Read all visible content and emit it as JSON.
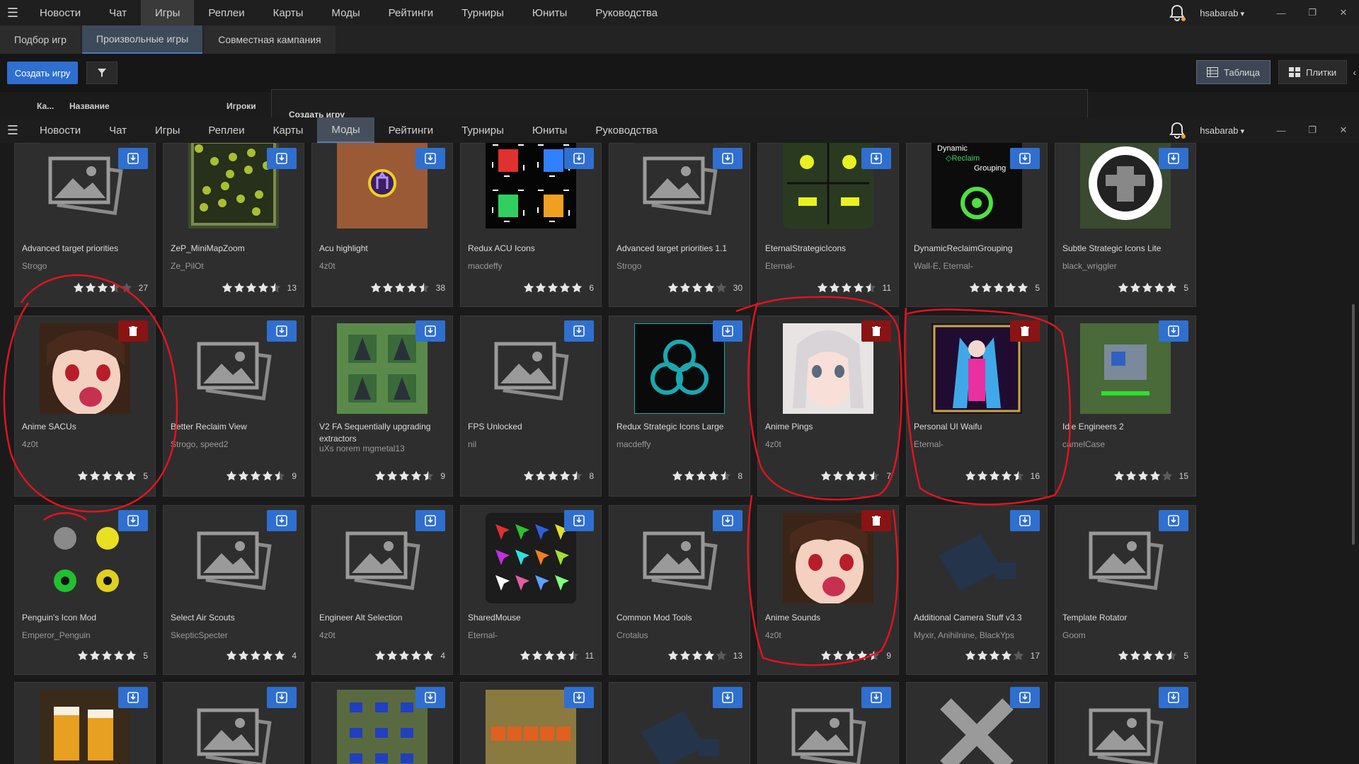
{
  "back_window": {
    "nav": [
      "Новости",
      "Чат",
      "Игры",
      "Реплеи",
      "Карты",
      "Моды",
      "Рейтинги",
      "Турниры",
      "Юниты",
      "Руководства"
    ],
    "active_nav": 2,
    "user": "hsabarab",
    "subtabs": [
      "Подбор игр",
      "Произвольные игры",
      "Совместная кампания"
    ],
    "active_subtab": 1,
    "create_button": "Создать игру",
    "view_table": "Таблица",
    "view_tiles": "Плитки",
    "table_headers": {
      "col1": "Ка...",
      "col2": "Название",
      "col3": "Игроки"
    },
    "create_panel_title": "Создать игру"
  },
  "front_window": {
    "nav": [
      "Новости",
      "Чат",
      "Игры",
      "Реплеи",
      "Карты",
      "Моды",
      "Рейтинги",
      "Турниры",
      "Юниты",
      "Руководства"
    ],
    "active_nav": 5,
    "user": "hsabarab"
  },
  "window_controls": {
    "minimize": "—",
    "maximize": "❐",
    "close": "✕"
  },
  "colors": {
    "accent": "#2f6fd0",
    "delete": "#8a1414",
    "annotation": "#e0141e"
  },
  "mods": [
    {
      "name": "Advanced target priorities",
      "author": "Strogo",
      "rating": 3.5,
      "count": "27",
      "action": "download",
      "image": "placeholder"
    },
    {
      "name": "ZeP_MiniMapZoom",
      "author": "Ze_PilOt",
      "rating": 4.5,
      "count": "13",
      "action": "download",
      "image": "minimap"
    },
    {
      "name": "Acu highlight",
      "author": "4z0t",
      "rating": 4.5,
      "count": "38",
      "action": "download",
      "image": "acu"
    },
    {
      "name": "Redux ACU Icons",
      "author": "macdeffy",
      "rating": 5,
      "count": "6",
      "action": "download",
      "image": "robots"
    },
    {
      "name": "Advanced target priorities 1.1",
      "author": "Strogo",
      "rating": 4,
      "count": "30",
      "action": "download",
      "image": "placeholder"
    },
    {
      "name": "EternalStrategicIcons",
      "author": "Eternal-",
      "rating": 4.5,
      "count": "11",
      "action": "download",
      "image": "eternal"
    },
    {
      "name": "DynamicReclaimGrouping",
      "author": "Wall-E, Eternal-",
      "rating": 5,
      "count": "5",
      "action": "download",
      "image": "reclaim"
    },
    {
      "name": "Subtle Strategic Icons Lite",
      "author": "black_wriggler",
      "rating": 5,
      "count": "5",
      "action": "download",
      "image": "subtle"
    },
    {
      "name": "Anime SACUs",
      "author": "4z0t",
      "rating": 5,
      "count": "5",
      "action": "delete",
      "image": "anime"
    },
    {
      "name": "Better Reclaim View",
      "author": "Strogo, speed2",
      "rating": 4.5,
      "count": "9",
      "action": "download",
      "image": "placeholder"
    },
    {
      "name": "V2 FA Sequentially upgrading extractors",
      "author": "uXs norem mgmetal13",
      "rating": 4.5,
      "count": "9",
      "action": "download",
      "image": "extractors"
    },
    {
      "name": "FPS Unlocked",
      "author": "nil",
      "rating": 4.5,
      "count": "8",
      "action": "download",
      "image": "placeholder"
    },
    {
      "name": "Redux Strategic Icons Large",
      "author": "macdeffy",
      "rating": 4.5,
      "count": "8",
      "action": "download",
      "image": "redux"
    },
    {
      "name": "Anime Pings",
      "author": "4z0t",
      "rating": 4.5,
      "count": "7",
      "action": "delete",
      "image": "anime2"
    },
    {
      "name": "Personal UI Waifu",
      "author": "Eternal-",
      "rating": 4.5,
      "count": "16",
      "action": "delete",
      "image": "waifu"
    },
    {
      "name": "Idle Engineers 2",
      "author": "camelCase",
      "rating": 4,
      "count": "15",
      "action": "download",
      "image": "engineers"
    },
    {
      "name": "Penguin's Icon Mod",
      "author": "Emperor_Penguin",
      "rating": 5,
      "count": "5",
      "action": "download",
      "image": "penguin"
    },
    {
      "name": "Select Air Scouts",
      "author": "SkepticSpecter",
      "rating": 5,
      "count": "4",
      "action": "download",
      "image": "placeholder"
    },
    {
      "name": "Engineer Alt Selection",
      "author": "4z0t",
      "rating": 5,
      "count": "4",
      "action": "download",
      "image": "placeholder"
    },
    {
      "name": "SharedMouse",
      "author": "Eternal-",
      "rating": 4.5,
      "count": "11",
      "action": "download",
      "image": "arrows"
    },
    {
      "name": "Common Mod Tools",
      "author": "Crotalus",
      "rating": 4,
      "count": "13",
      "action": "download",
      "image": "placeholder"
    },
    {
      "name": "Anime Sounds",
      "author": "4z0t",
      "rating": 4.5,
      "count": "9",
      "action": "delete",
      "image": "anime"
    },
    {
      "name": "Additional Camera Stuff v3.3",
      "author": "Myxir, Anihilnine, BlackYps",
      "rating": 4,
      "count": "17",
      "action": "download",
      "image": "camera"
    },
    {
      "name": "Template Rotator",
      "author": "Goom",
      "rating": 4.5,
      "count": "5",
      "action": "download",
      "image": "placeholder"
    },
    {
      "name": "",
      "author": "",
      "rating": 0,
      "count": "",
      "action": "download",
      "image": "beer"
    },
    {
      "name": "",
      "author": "",
      "rating": 0,
      "count": "",
      "action": "download",
      "image": "placeholder"
    },
    {
      "name": "",
      "author": "",
      "rating": 0,
      "count": "",
      "action": "download",
      "image": "icons-grid"
    },
    {
      "name": "",
      "author": "",
      "rating": 0,
      "count": "",
      "action": "download",
      "image": "numbers"
    },
    {
      "name": "",
      "author": "",
      "rating": 0,
      "count": "",
      "action": "download",
      "image": "camera"
    },
    {
      "name": "",
      "author": "",
      "rating": 0,
      "count": "",
      "action": "download",
      "image": "placeholder"
    },
    {
      "name": "",
      "author": "",
      "rating": 0,
      "count": "",
      "action": "download",
      "image": "cross"
    },
    {
      "name": "",
      "author": "",
      "rating": 0,
      "count": "",
      "action": "download",
      "image": "placeholder"
    }
  ]
}
